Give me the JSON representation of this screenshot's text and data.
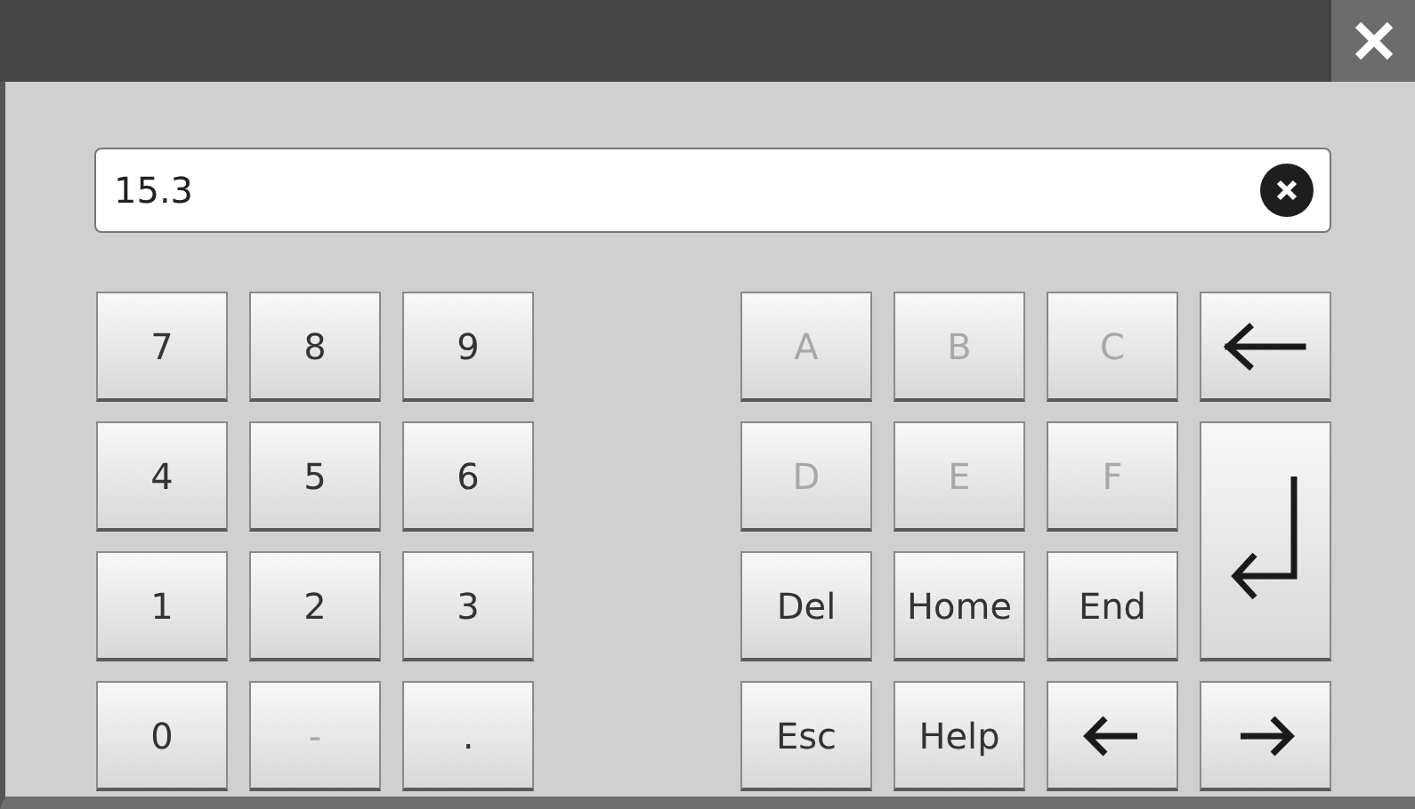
{
  "input": {
    "value": "15.3"
  },
  "numeric_keys": [
    {
      "kind": "text",
      "label": "7",
      "disabled": false
    },
    {
      "kind": "text",
      "label": "8",
      "disabled": false
    },
    {
      "kind": "text",
      "label": "9",
      "disabled": false
    },
    {
      "kind": "text",
      "label": "4",
      "disabled": false
    },
    {
      "kind": "text",
      "label": "5",
      "disabled": false
    },
    {
      "kind": "text",
      "label": "6",
      "disabled": false
    },
    {
      "kind": "text",
      "label": "1",
      "disabled": false
    },
    {
      "kind": "text",
      "label": "2",
      "disabled": false
    },
    {
      "kind": "text",
      "label": "3",
      "disabled": false
    },
    {
      "kind": "text",
      "label": "0",
      "disabled": false
    },
    {
      "kind": "text",
      "label": "-",
      "disabled": true
    },
    {
      "kind": "text",
      "label": ".",
      "disabled": false
    }
  ],
  "function_keys": [
    {
      "kind": "text",
      "label": "A",
      "disabled": true
    },
    {
      "kind": "text",
      "label": "B",
      "disabled": true
    },
    {
      "kind": "text",
      "label": "C",
      "disabled": true
    },
    {
      "kind": "backspace",
      "disabled": false
    },
    {
      "kind": "text",
      "label": "D",
      "disabled": true
    },
    {
      "kind": "text",
      "label": "E",
      "disabled": true
    },
    {
      "kind": "text",
      "label": "F",
      "disabled": true
    },
    {
      "kind": "enter",
      "disabled": false
    },
    {
      "kind": "text",
      "label": "Del",
      "disabled": false
    },
    {
      "kind": "text",
      "label": "Home",
      "disabled": false
    },
    {
      "kind": "text",
      "label": "End",
      "disabled": false
    },
    {
      "kind": "text",
      "label": "Esc",
      "disabled": false
    },
    {
      "kind": "text",
      "label": "Help",
      "disabled": false
    },
    {
      "kind": "left",
      "disabled": false
    },
    {
      "kind": "right",
      "disabled": false
    }
  ]
}
